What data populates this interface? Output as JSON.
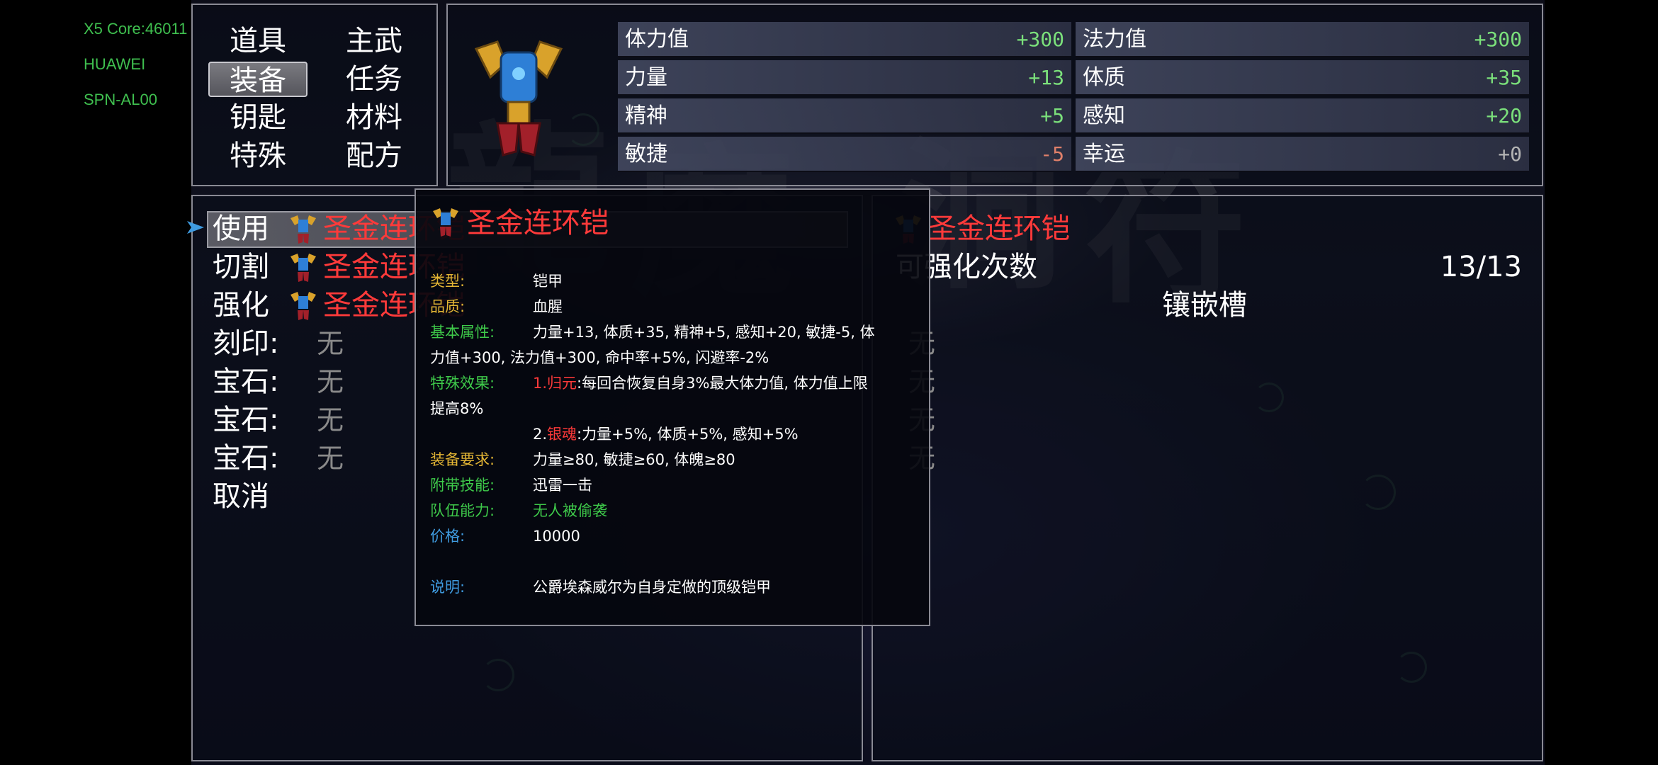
{
  "device_info": [
    "X5 Core:46011",
    "HUAWEI",
    "SPN-AL00"
  ],
  "categories": [
    {
      "label": "道具",
      "selected": false
    },
    {
      "label": "主武",
      "selected": false
    },
    {
      "label": "装备",
      "selected": true
    },
    {
      "label": "任务",
      "selected": false
    },
    {
      "label": "钥匙",
      "selected": false
    },
    {
      "label": "材料",
      "selected": false
    },
    {
      "label": "特殊",
      "selected": false
    },
    {
      "label": "配方",
      "selected": false
    }
  ],
  "stats": [
    {
      "label": "体力值",
      "value": "+300",
      "color": "#7be07b"
    },
    {
      "label": "法力值",
      "value": "+300",
      "color": "#7be07b"
    },
    {
      "label": "力量",
      "value": "+13",
      "color": "#7be07b"
    },
    {
      "label": "体质",
      "value": "+35",
      "color": "#7be07b"
    },
    {
      "label": "精神",
      "value": "+5",
      "color": "#7be07b"
    },
    {
      "label": "感知",
      "value": "+20",
      "color": "#7be07b"
    },
    {
      "label": "敏捷",
      "value": "-5",
      "color": "#e0806a"
    },
    {
      "label": "幸运",
      "value": "+0",
      "color": "#b5b5b5"
    }
  ],
  "actions": {
    "use": "使用",
    "cut": "切割",
    "enhance": "强化",
    "engrave": "刻印:",
    "gem1": "宝石:",
    "gem2": "宝石:",
    "gem3": "宝石:",
    "cancel": "取消",
    "none": "无",
    "item_name": "圣金连环铠"
  },
  "tooltip": {
    "title": "圣金连环铠",
    "rows": [
      {
        "key": "类型:",
        "value": "铠甲",
        "kcolor": "k-yellow"
      },
      {
        "key": "品质:",
        "value": "血腥",
        "kcolor": "k-yellow"
      },
      {
        "key": "基本属性:",
        "value": "力量+13, 体质+35, 精神+5, 感知+20, 敏捷-5, 体",
        "kcolor": "k-green"
      },
      {
        "key": "",
        "value": "力值+300, 法力值+300, 命中率+5%, 闪避率-2%",
        "kcolor": "k-green"
      },
      {
        "key": "特殊效果:",
        "value": "1.归元:每回合恢复自身3%最大体力值, 体力值上限",
        "kcolor": "k-green"
      },
      {
        "key": "提高8%",
        "value": "",
        "kcolor": "white"
      },
      {
        "key": "",
        "value": "2.银魂:力量+5%, 体质+5%, 感知+5%",
        "kcolor": "k-green"
      },
      {
        "key": "装备要求:",
        "value": "力量≥80, 敏捷≥60, 体魄≥80",
        "kcolor": "k-yellow"
      },
      {
        "key": "附带技能:",
        "value": "迅雷一击",
        "kcolor": "k-green"
      },
      {
        "key": "队伍能力:",
        "value": "无人被偷袭",
        "kcolor": "k-green"
      },
      {
        "key": "价格:",
        "value": "10000",
        "kcolor": "k-blue"
      },
      {
        "key": "说明:",
        "value": "公爵埃森威尔为自身定做的顶级铠甲",
        "kcolor": "k-blue"
      }
    ],
    "effect1_num": "1.",
    "effect1_name": "归元",
    "effect1_text": ":每回合恢复自身3%最大体力值, 体力值上限",
    "effect2_num": "2.",
    "effect2_name": "银魂",
    "effect2_text": ":力量+5%, 体质+5%, 感知+5%"
  },
  "right_panel": {
    "item_name": "圣金连环铠",
    "enhance_label": "可强化次数",
    "enhance_count": "13/13",
    "socket_label": "镶嵌槽",
    "none": "无"
  },
  "icons": {
    "armor": "armor-icon",
    "cursor": "selection-arrow-icon"
  }
}
